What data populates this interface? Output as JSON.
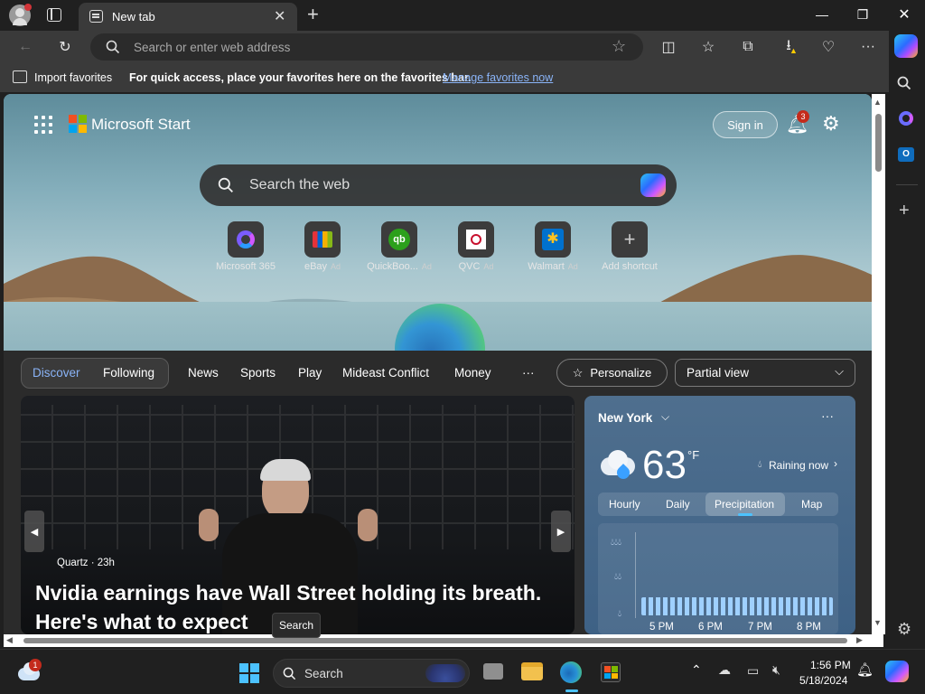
{
  "browser": {
    "tab_title": "New tab",
    "address_placeholder": "Search or enter web address"
  },
  "favorites_bar": {
    "import_label": "Import favorites",
    "message": "For quick access, place your favorites here on the favorites bar.",
    "manage_link": "Manage favorites now"
  },
  "start_page": {
    "brand": "Microsoft Start",
    "sign_in": "Sign in",
    "notification_count": "3",
    "search_placeholder": "Search the web",
    "shortcuts": [
      {
        "label": "Microsoft 365",
        "ad": ""
      },
      {
        "label": "eBay",
        "ad": "Ad"
      },
      {
        "label": "QuickBoo...",
        "ad": "Ad"
      },
      {
        "label": "QVC",
        "ad": "Ad"
      },
      {
        "label": "Walmart",
        "ad": "Ad"
      },
      {
        "label": "Add shortcut",
        "ad": ""
      }
    ]
  },
  "feed_nav": {
    "discover": "Discover",
    "following": "Following",
    "items": [
      "News",
      "Sports",
      "Play",
      "Mideast Conflict",
      "Money"
    ],
    "more": "···",
    "personalize": "Personalize",
    "view_select": "Partial view"
  },
  "hero_story": {
    "source": "Quartz · 23h",
    "headline_line1": "Nvidia earnings have Wall Street holding its breath.",
    "headline_line2": "Here's what to expect"
  },
  "weather": {
    "location": "New York",
    "temperature": "63",
    "unit": "°F",
    "condition": "Raining now",
    "tabs": [
      "Hourly",
      "Daily",
      "Precipitation",
      "Map"
    ],
    "active_tab": "Precipitation",
    "times": [
      "5 PM",
      "6 PM",
      "7 PM",
      "8 PM"
    ]
  },
  "taskbar": {
    "search_label": "Search",
    "tooltip": "Search",
    "time": "1:56 PM",
    "date": "5/18/2024",
    "widgets_badge": "1"
  },
  "colors": {
    "link": "#8ab4f8",
    "accent": "#4cc2ff",
    "badge": "#c42b1c"
  }
}
